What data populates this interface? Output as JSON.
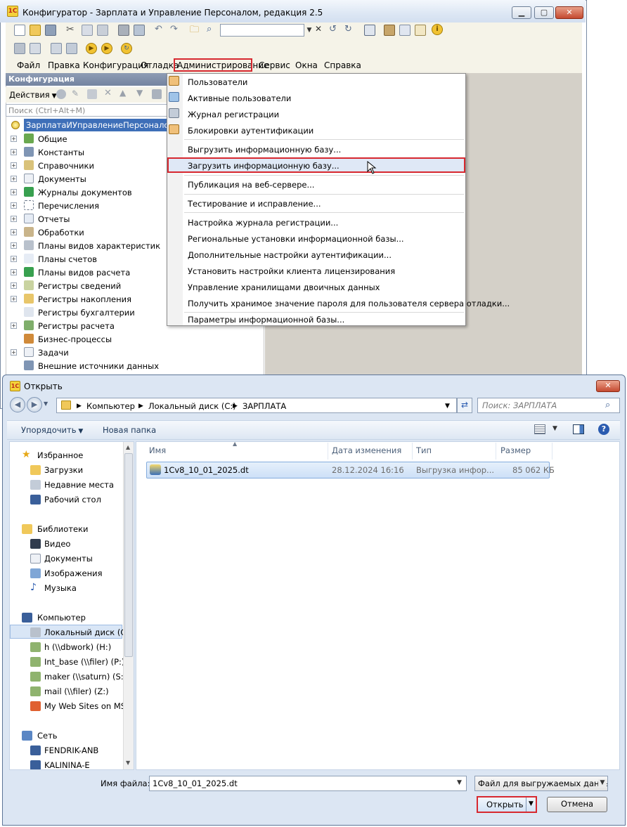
{
  "configurator": {
    "window_title": "Конфигуратор - Зарплата и Управление Персоналом, редакция 2.5",
    "menu": [
      "Файл",
      "Правка",
      "Конфигурация",
      "Отладка",
      "Администрирование",
      "Сервис",
      "Окна",
      "Справка"
    ],
    "panel_title": "Конфигурация",
    "actions_label": "Действия",
    "search_placeholder": "Поиск (Ctrl+Alt+M)",
    "tree_root": "ЗарплатаИУправлениеПерсоналом",
    "tree": [
      "Общие",
      "Константы",
      "Справочники",
      "Документы",
      "Журналы документов",
      "Перечисления",
      "Отчеты",
      "Обработки",
      "Планы видов характеристик",
      "Планы счетов",
      "Планы видов расчета",
      "Регистры сведений",
      "Регистры накопления",
      "Регистры бухгалтерии",
      "Регистры расчета",
      "Бизнес-процессы",
      "Задачи",
      "Внешние источники данных"
    ],
    "admin_menu": [
      "Пользователи",
      "Активные пользователи",
      "Журнал регистрации",
      "Блокировки аутентификации",
      "Выгрузить информационную базу...",
      "Загрузить информационную базу...",
      "Публикация на веб-сервере...",
      "Тестирование и исправление...",
      "Настройка журнала регистрации...",
      "Региональные установки информационной базы...",
      "Дополнительные настройки аутентификации...",
      "Установить настройки клиента лицензирования",
      "Управление хранилищами двоичных данных",
      "Получить хранимое значение пароля для пользователя сервера отладки...",
      "Параметры информационной базы..."
    ]
  },
  "dialog": {
    "title": "Открыть",
    "breadcrumb": [
      "Компьютер",
      "Локальный диск (C:)",
      "ЗАРПЛАТА"
    ],
    "search_placeholder": "Поиск: ЗАРПЛАТА",
    "organize": "Упорядочить",
    "new_folder": "Новая папка",
    "nav": {
      "favorites": "Избранное",
      "fav_items": [
        "Загрузки",
        "Недавние места",
        "Рабочий стол"
      ],
      "libraries": "Библиотеки",
      "lib_items": [
        "Видео",
        "Документы",
        "Изображения",
        "Музыка"
      ],
      "computer": "Компьютер",
      "comp_items": [
        "Локальный диск (C:)",
        "h (\\\\dbwork) (H:)",
        "Int_base (\\\\filer) (P:)",
        "maker (\\\\saturn) (S:)",
        "mail (\\\\filer) (Z:)",
        "My Web Sites on MSN"
      ],
      "network": "Сеть",
      "net_items": [
        "FENDRIK-ANB",
        "KALININA-E"
      ]
    },
    "columns": [
      "Имя",
      "Дата изменения",
      "Тип",
      "Размер"
    ],
    "file": {
      "name": "1Cv8_10_01_2025.dt",
      "date": "28.12.2024 16:16",
      "type": "Выгрузка инфор...",
      "size": "85 062 КБ"
    },
    "filename_label": "Имя файла:",
    "filename_value": "1Cv8_10_01_2025.dt",
    "filetype": "Файл для выгружаемых данных",
    "open_button": "Открыть",
    "cancel_button": "Отмена"
  },
  "colors": {
    "highlight_border": "#d7282f",
    "selection": "#3e6fb8"
  }
}
